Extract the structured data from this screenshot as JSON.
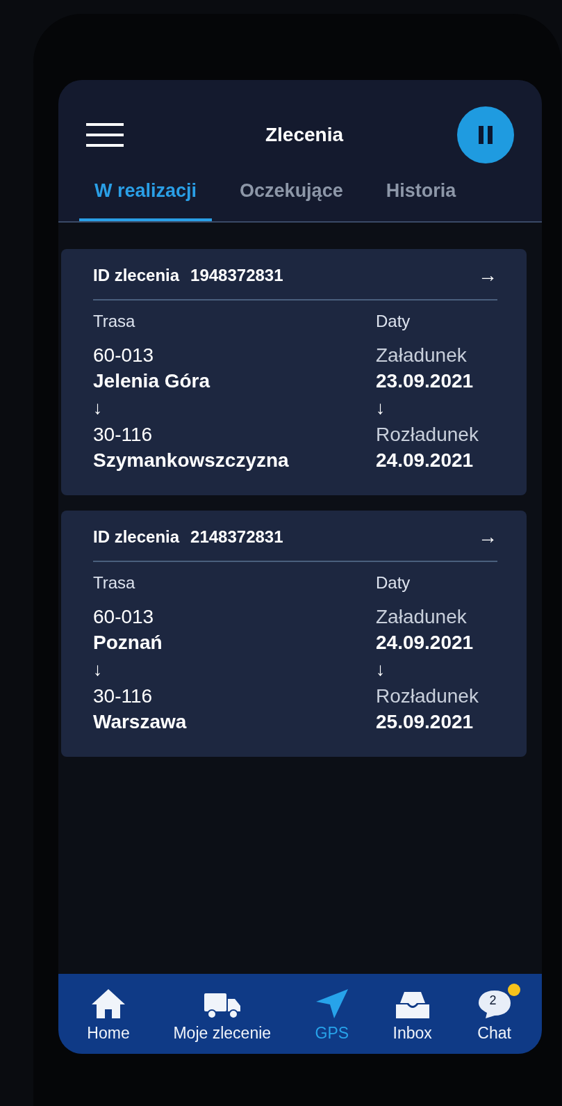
{
  "header": {
    "title": "Zlecenia"
  },
  "tabs": [
    {
      "label": "W realizacji",
      "selected": true
    },
    {
      "label": "Oczekujące",
      "selected": false
    },
    {
      "label": "Historia",
      "selected": false
    }
  ],
  "orders": [
    {
      "id_label": "ID zlecenia",
      "id": "1948372831",
      "open_arrow": "→",
      "route_label": "Trasa",
      "from_code": "60-013",
      "from_city": "Jelenia Góra",
      "route_arrow": "↓",
      "to_code": "30-116",
      "to_city": "Szymankowszczyzna",
      "dates_label": "Daty",
      "loading_label": "Załadunek",
      "loading_date": "23.09.2021",
      "dates_arrow": "↓",
      "unloading_label": "Rozładunek",
      "unloading_date": "24.09.2021"
    },
    {
      "id_label": "ID zlecenia",
      "id": "2148372831",
      "open_arrow": "→",
      "route_label": "Trasa",
      "from_code": "60-013",
      "from_city": "Poznań",
      "route_arrow": "↓",
      "to_code": "30-116",
      "to_city": "Warszawa",
      "dates_label": "Daty",
      "loading_label": "Załadunek",
      "loading_date": "24.09.2021",
      "dates_arrow": "↓",
      "unloading_label": "Rozładunek",
      "unloading_date": "25.09.2021"
    }
  ],
  "nav": [
    {
      "kind": "home",
      "label": "Home",
      "selected": false
    },
    {
      "kind": "truck",
      "label": "Moje zlecenie",
      "selected": false
    },
    {
      "kind": "gps",
      "label": "GPS",
      "selected": true
    },
    {
      "kind": "inbox",
      "label": "Inbox",
      "selected": false
    },
    {
      "kind": "chat",
      "label": "Chat",
      "selected": false,
      "badge": "2"
    }
  ]
}
